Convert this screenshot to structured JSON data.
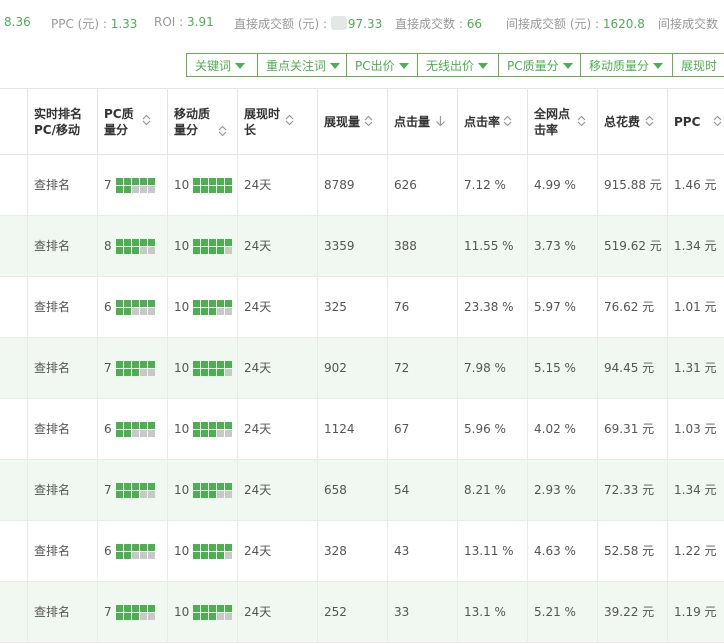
{
  "stats": [
    {
      "label": "",
      "value": "8.36",
      "blur": false
    },
    {
      "label": "PPC (元) : ",
      "value": "1.33",
      "blur": false
    },
    {
      "label": "ROI : ",
      "value": "3.91",
      "blur": false
    },
    {
      "label": "直接成交额 (元) : ",
      "value": "97.33",
      "blur": true
    },
    {
      "label": "直接成交数 : ",
      "value": "66",
      "blur": false
    },
    {
      "label": "间接成交额 (元) : ",
      "value": "1620.8",
      "blur": false
    },
    {
      "label": "间接成交数",
      "value": "",
      "blur": false
    }
  ],
  "filters": [
    "关键词",
    "重点关注词",
    "PC出价",
    "无线出价",
    "PC质量分",
    "移动质量分",
    "展现时"
  ],
  "headers": [
    {
      "label": "",
      "sort": "none"
    },
    {
      "label": "实时排名PC/移动",
      "sort": "none"
    },
    {
      "label": "PC质量分",
      "sort": "both"
    },
    {
      "label": "移动质量分",
      "sort": "both"
    },
    {
      "label": "展现时长",
      "sort": "both"
    },
    {
      "label": "展现量",
      "sort": "both"
    },
    {
      "label": "点击量",
      "sort": "down"
    },
    {
      "label": "点击率",
      "sort": "both"
    },
    {
      "label": "全网点击率",
      "sort": "both"
    },
    {
      "label": "总花费",
      "sort": "both"
    },
    {
      "label": "PPC",
      "sort": "both"
    }
  ],
  "bar_colors": {
    "on": "#4caf50",
    "off": "#c8c8c8"
  },
  "rows": [
    {
      "rank": "查排名",
      "pc_score": "7",
      "pc_level": 7,
      "mobile_score": "10",
      "mobile_level": 10,
      "duration": "24天",
      "impressions": "8789",
      "clicks": "626",
      "ctr": "7.12 %",
      "net_ctr": "4.99 %",
      "cost": "915.88 元",
      "ppc": "1.46 元"
    },
    {
      "rank": "查排名",
      "pc_score": "8",
      "pc_level": 8,
      "mobile_score": "10",
      "mobile_level": 9,
      "duration": "24天",
      "impressions": "3359",
      "clicks": "388",
      "ctr": "11.55 %",
      "net_ctr": "3.73 %",
      "cost": "519.62 元",
      "ppc": "1.34 元"
    },
    {
      "rank": "查排名",
      "pc_score": "6",
      "pc_level": 7,
      "mobile_score": "10",
      "mobile_level": 8,
      "duration": "24天",
      "impressions": "325",
      "clicks": "76",
      "ctr": "23.38 %",
      "net_ctr": "5.97 %",
      "cost": "76.62 元",
      "ppc": "1.01 元"
    },
    {
      "rank": "查排名",
      "pc_score": "7",
      "pc_level": 8,
      "mobile_score": "10",
      "mobile_level": 9,
      "duration": "24天",
      "impressions": "902",
      "clicks": "72",
      "ctr": "7.98 %",
      "net_ctr": "5.15 %",
      "cost": "94.45 元",
      "ppc": "1.31 元"
    },
    {
      "rank": "查排名",
      "pc_score": "6",
      "pc_level": 7,
      "mobile_score": "10",
      "mobile_level": 8,
      "duration": "24天",
      "impressions": "1124",
      "clicks": "67",
      "ctr": "5.96 %",
      "net_ctr": "4.02 %",
      "cost": "69.31 元",
      "ppc": "1.03 元"
    },
    {
      "rank": "查排名",
      "pc_score": "7",
      "pc_level": 8,
      "mobile_score": "10",
      "mobile_level": 8,
      "duration": "24天",
      "impressions": "658",
      "clicks": "54",
      "ctr": "8.21 %",
      "net_ctr": "2.93 %",
      "cost": "72.33 元",
      "ppc": "1.34 元"
    },
    {
      "rank": "查排名",
      "pc_score": "6",
      "pc_level": 7,
      "mobile_score": "10",
      "mobile_level": 9,
      "duration": "24天",
      "impressions": "328",
      "clicks": "43",
      "ctr": "13.11 %",
      "net_ctr": "4.63 %",
      "cost": "52.58 元",
      "ppc": "1.22 元"
    },
    {
      "rank": "查排名",
      "pc_score": "7",
      "pc_level": 8,
      "mobile_score": "10",
      "mobile_level": 8,
      "duration": "24天",
      "impressions": "252",
      "clicks": "33",
      "ctr": "13.1 %",
      "net_ctr": "5.21 %",
      "cost": "39.22 元",
      "ppc": "1.19 元"
    }
  ]
}
